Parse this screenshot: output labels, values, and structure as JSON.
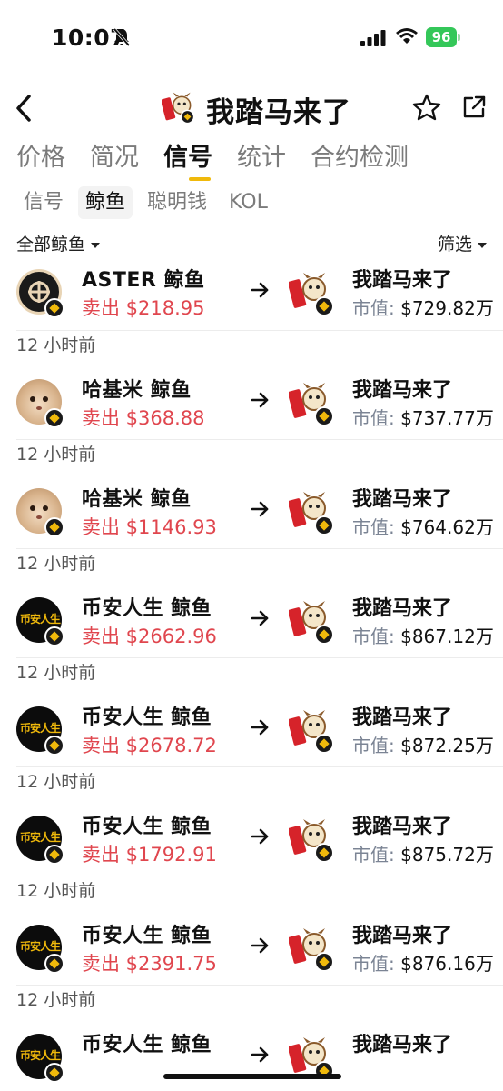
{
  "status": {
    "time": "10:07",
    "battery": "96"
  },
  "header": {
    "title": "我踏马来了"
  },
  "main_tabs": [
    {
      "label": "价格",
      "active": false
    },
    {
      "label": "简况",
      "active": false
    },
    {
      "label": "信号",
      "active": true
    },
    {
      "label": "统计",
      "active": false
    },
    {
      "label": "合约检测",
      "active": false
    }
  ],
  "sub_tabs": [
    {
      "label": "信号",
      "active": false
    },
    {
      "label": "鲸鱼",
      "active": true
    },
    {
      "label": "聪明钱",
      "active": false
    },
    {
      "label": "KOL",
      "active": false
    }
  ],
  "filter": {
    "left_label": "全部鲸鱼",
    "right_label": "筛选"
  },
  "labels": {
    "mcap_prefix": "市值: ",
    "time_ago": "12 小时前",
    "sell_prefix": "卖出 "
  },
  "colors": {
    "accent": "#f0b90b",
    "sell": "#e0464e",
    "battery": "#34c759"
  },
  "rows": [
    {
      "time": "",
      "avatar": "aster",
      "whale": "ASTER 鲸鱼",
      "sell": "卖出 $218.95",
      "token": "我踏马来了",
      "mcap": "$729.82万"
    },
    {
      "time": "12 小时前",
      "avatar": "hamster",
      "whale": "哈基米 鲸鱼",
      "sell": "卖出 $368.88",
      "token": "我踏马来了",
      "mcap": "$737.77万"
    },
    {
      "time": "12 小时前",
      "avatar": "hamster",
      "whale": "哈基米 鲸鱼",
      "sell": "卖出 $1146.93",
      "token": "我踏马来了",
      "mcap": "$764.62万"
    },
    {
      "time": "12 小时前",
      "avatar": "binance-life",
      "whale": "币安人生 鲸鱼",
      "sell": "卖出 $2662.96",
      "token": "我踏马来了",
      "mcap": "$867.12万"
    },
    {
      "time": "12 小时前",
      "avatar": "binance-life",
      "whale": "币安人生 鲸鱼",
      "sell": "卖出 $2678.72",
      "token": "我踏马来了",
      "mcap": "$872.25万"
    },
    {
      "time": "12 小时前",
      "avatar": "binance-life",
      "whale": "币安人生 鲸鱼",
      "sell": "卖出 $1792.91",
      "token": "我踏马来了",
      "mcap": "$875.72万"
    },
    {
      "time": "12 小时前",
      "avatar": "binance-life",
      "whale": "币安人生 鲸鱼",
      "sell": "卖出 $2391.75",
      "token": "我踏马来了",
      "mcap": "$876.16万"
    },
    {
      "time": "12 小时前",
      "avatar": "binance-life",
      "whale": "币安人生 鲸鱼",
      "sell": "",
      "token": "我踏马来了",
      "mcap": ""
    }
  ],
  "avatar_text": {
    "binance-life": "币安人生"
  }
}
